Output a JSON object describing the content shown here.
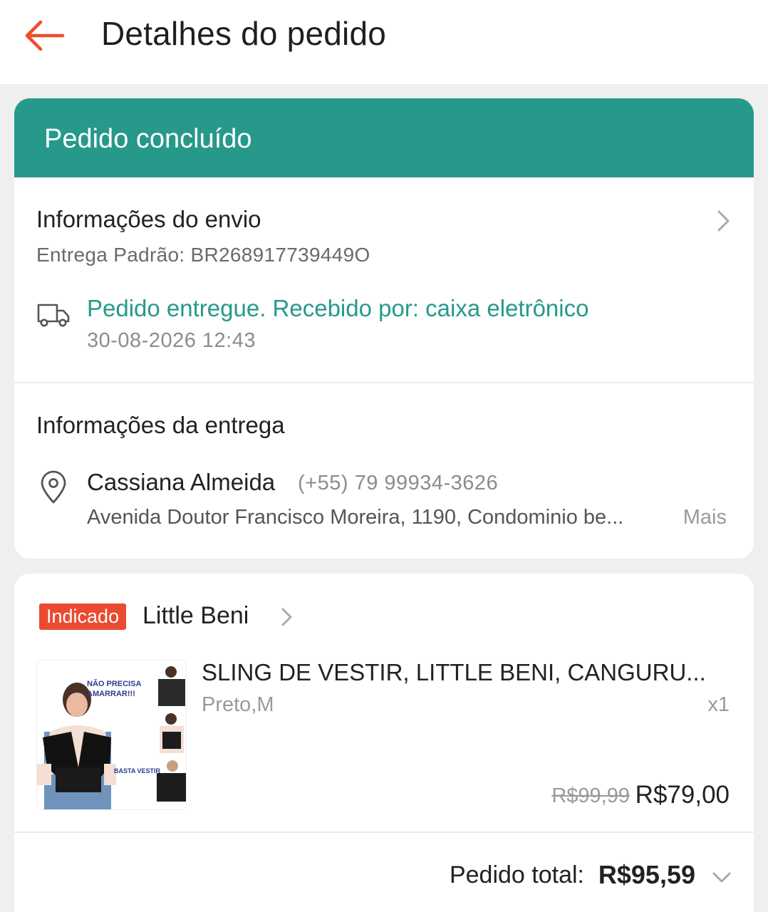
{
  "header": {
    "title": "Detalhes do pedido",
    "accent_color": "#ee4d2d"
  },
  "status": {
    "label": "Pedido concluído",
    "color": "#26998a"
  },
  "shipping": {
    "title": "Informações do envio",
    "tracking": "Entrega Padrão: BR268917739449O",
    "delivery_status": "Pedido entregue. Recebido por: caixa eletrônico",
    "delivery_time": "30-08-2026 12:43"
  },
  "address": {
    "title": "Informações da entrega",
    "recipient_name": "Cassiana Almeida",
    "phone": "(+55) 79 99934-3626",
    "line": "Avenida Doutor Francisco Moreira, 1190, Condominio be...",
    "more_label": "Mais"
  },
  "shop": {
    "badge": "Indicado",
    "name": "Little Beni"
  },
  "product": {
    "name": "SLING DE VESTIR, LITTLE BENI, CANGURU...",
    "variant": "Preto,M",
    "quantity": "x1",
    "original_price": "R$99,99",
    "price": "R$79,00",
    "image_text_top": "NÃO PRECISA AMARRAR!!!",
    "image_text_bottom": "BASTA VESTIR"
  },
  "total": {
    "label": "Pedido total:",
    "value": "R$95,59"
  }
}
